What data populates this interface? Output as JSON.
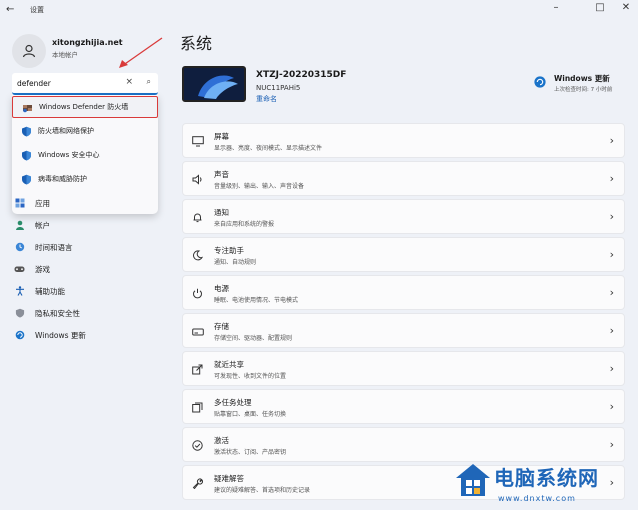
{
  "window": {
    "app_title": "设置",
    "back_glyph": "←",
    "minimize_glyph": "–",
    "maximize_glyph": "□",
    "close_glyph": "✕"
  },
  "user": {
    "name": "xitongzhijia.net",
    "account_type": "本地帐户"
  },
  "search": {
    "value": "defender",
    "clear_glyph": "×",
    "search_glyph": "⌕"
  },
  "search_results": [
    {
      "label": "Windows Defender 防火墙",
      "icon": "firewall-icon",
      "highlighted": true
    },
    {
      "label": "防火墙和网络保护",
      "icon": "shield-icon",
      "highlighted": false
    },
    {
      "label": "Windows 安全中心",
      "icon": "shield-icon",
      "highlighted": false
    },
    {
      "label": "病毒和威胁防护",
      "icon": "shield-icon",
      "highlighted": false
    }
  ],
  "sidebar": {
    "items": [
      {
        "label": "应用",
        "icon": "apps-icon"
      },
      {
        "label": "帐户",
        "icon": "account-icon"
      },
      {
        "label": "时间和语言",
        "icon": "globe-clock-icon"
      },
      {
        "label": "游戏",
        "icon": "gamepad-icon"
      },
      {
        "label": "辅助功能",
        "icon": "accessibility-icon"
      },
      {
        "label": "隐私和安全性",
        "icon": "shield-icon"
      },
      {
        "label": "Windows 更新",
        "icon": "update-icon"
      }
    ]
  },
  "main": {
    "title": "系统",
    "device": {
      "name": "XTZJ-20220315DF",
      "model": "NUC11PAHi5",
      "rename_link": "重命名"
    },
    "update": {
      "title": "Windows 更新",
      "subtitle": "上次检查时间: 7 小时前"
    },
    "cards": [
      {
        "title": "屏幕",
        "subtitle": "显示器、亮度、夜间模式、显示描述文件",
        "icon": "monitor-icon"
      },
      {
        "title": "声音",
        "subtitle": "音量级别、输出、输入、声音设备",
        "icon": "speaker-icon"
      },
      {
        "title": "通知",
        "subtitle": "来自应用和系统的警报",
        "icon": "bell-icon"
      },
      {
        "title": "专注助手",
        "subtitle": "通知、自动规则",
        "icon": "moon-icon"
      },
      {
        "title": "电源",
        "subtitle": "睡眠、电池使用情况、节电模式",
        "icon": "power-icon"
      },
      {
        "title": "存储",
        "subtitle": "存储空间、驱动器、配置规则",
        "icon": "storage-icon"
      },
      {
        "title": "就近共享",
        "subtitle": "可发现性、收到文件的位置",
        "icon": "share-icon"
      },
      {
        "title": "多任务处理",
        "subtitle": "贴靠窗口、桌面、任务切换",
        "icon": "multitask-icon"
      },
      {
        "title": "激活",
        "subtitle": "激活状态、订阅、产品密钥",
        "icon": "check-circle-icon"
      },
      {
        "title": "疑难解答",
        "subtitle": "建议的疑难解答、首选项和历史记录",
        "icon": "wrench-icon"
      }
    ],
    "chevron_glyph": "›"
  },
  "watermark": {
    "title": "电脑系统网",
    "url": "www.dnxtw.com"
  },
  "colors": {
    "accent": "#1a73c9",
    "annotation_red": "#d93a3a",
    "shield_blue": "#1a5fb4",
    "watermark_blue": "#1f66b8"
  }
}
